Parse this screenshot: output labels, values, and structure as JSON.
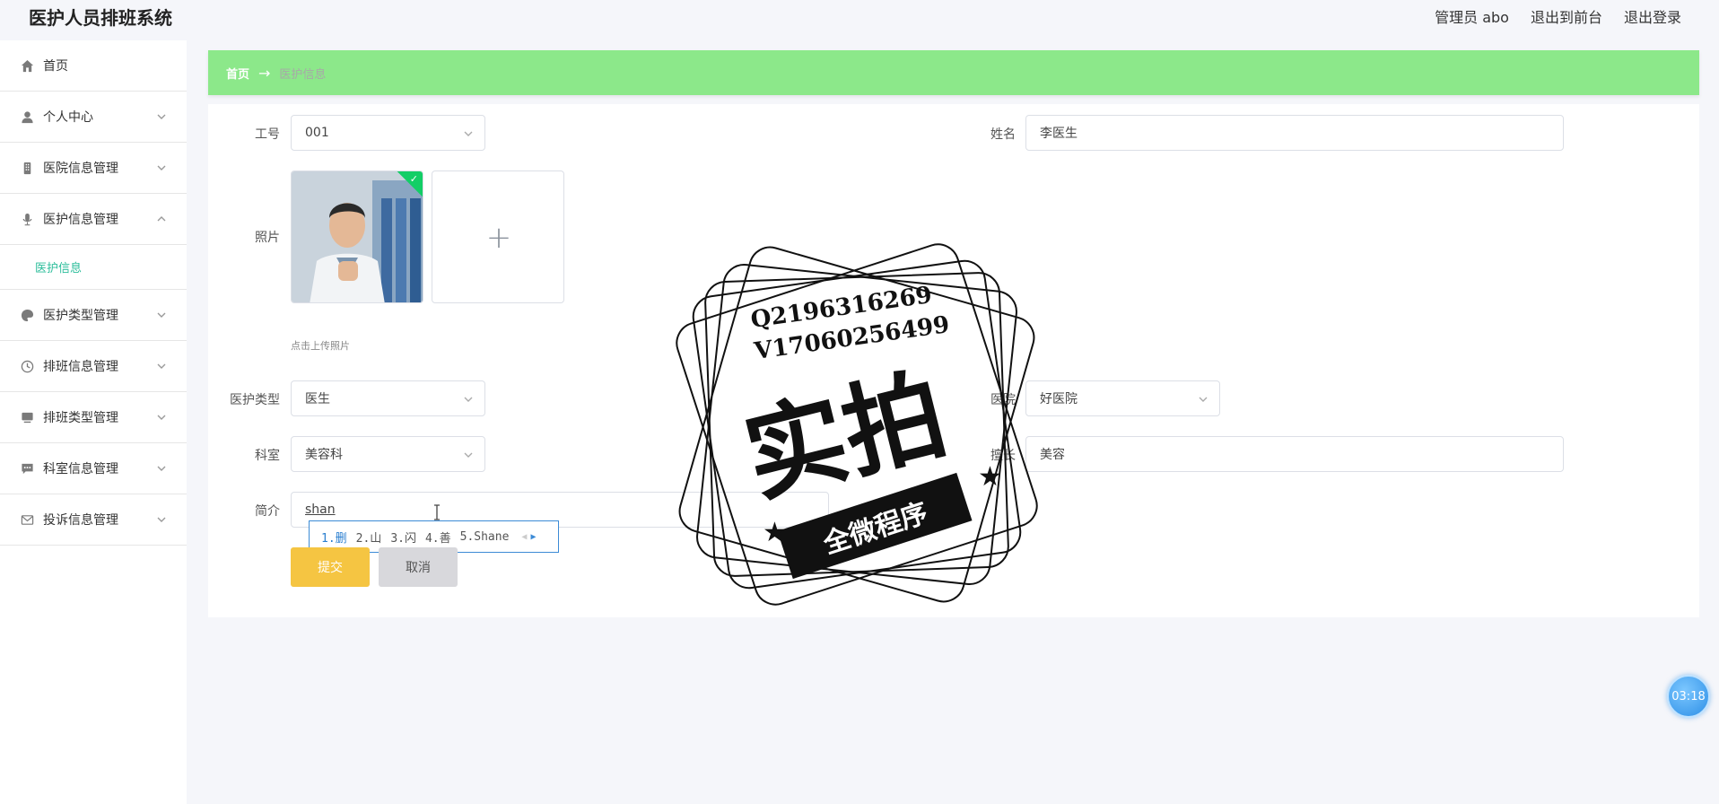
{
  "header": {
    "title": "医护人员排班系统",
    "admin_label": "管理员 abo",
    "exit_front": "退出到前台",
    "logout": "退出登录"
  },
  "sidebar": {
    "items": [
      {
        "label": "首页",
        "icon": "home-icon"
      },
      {
        "label": "个人中心",
        "icon": "user-icon"
      },
      {
        "label": "医院信息管理",
        "icon": "building-icon"
      },
      {
        "label": "医护信息管理",
        "icon": "microphone-icon",
        "expanded": true
      },
      {
        "label": "医护类型管理",
        "icon": "palette-icon"
      },
      {
        "label": "排班信息管理",
        "icon": "clock-icon"
      },
      {
        "label": "排班类型管理",
        "icon": "monitor-icon"
      },
      {
        "label": "科室信息管理",
        "icon": "chat-icon"
      },
      {
        "label": "投诉信息管理",
        "icon": "mail-icon"
      }
    ],
    "sub_item": "医护信息"
  },
  "breadcrumb": {
    "home": "首页",
    "arrow": "→",
    "current": "医护信息"
  },
  "form": {
    "job_no_label": "工号",
    "job_no_value": "001",
    "name_label": "姓名",
    "name_value": "李医生",
    "photo_label": "照片",
    "upload_hint": "点击上传照片",
    "type_label": "医护类型",
    "type_value": "医生",
    "hospital_label": "医院",
    "hospital_value": "好医院",
    "dept_label": "科室",
    "dept_value": "美容科",
    "specialty_label": "擅长",
    "specialty_value": "美容",
    "intro_label": "简介",
    "intro_value": "shan",
    "submit": "提交",
    "cancel": "取消"
  },
  "ime": {
    "candidates": [
      "1.删",
      "2.山",
      "3.闪",
      "4.善",
      "5.Shane"
    ]
  },
  "watermark": {
    "line1": "Q2196316269",
    "line2": "V17060256499",
    "big": "实拍",
    "ribbon": "全微程序"
  },
  "timer": "03:18"
}
